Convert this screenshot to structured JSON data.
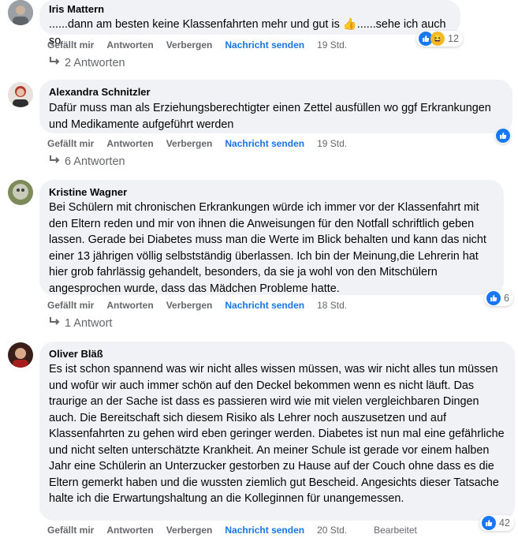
{
  "comments": [
    {
      "author": "Iris Mattern",
      "text": "......dann am besten keine Klassenfahrten mehr und gut is 👍......sehe ich auch so",
      "actions": {
        "like": "Gefällt mir",
        "reply": "Antworten",
        "hide": "Verbergen",
        "send": "Nachricht senden",
        "time": "19 Std."
      },
      "reaction_count": "12",
      "replies": "2 Antworten"
    },
    {
      "author": "Alexandra Schnitzler",
      "text": "Dafür muss man als Erziehungsberechtigter einen Zettel ausfüllen wo ggf Erkrankungen und Medikamente aufgeführt werden",
      "actions": {
        "like": "Gefällt mir",
        "reply": "Antworten",
        "hide": "Verbergen",
        "send": "Nachricht senden",
        "time": "19 Std."
      },
      "replies": "6 Antworten"
    },
    {
      "author": "Kristine Wagner",
      "text": "Bei Schülern mit chronischen Erkrankungen würde ich immer vor der Klassenfahrt mit den Eltern reden und mir von ihnen die Anweisungen für den Notfall schriftlich geben lassen. Gerade bei Diabetes muss man die Werte im Blick behalten und kann das nicht einer 13 jährigen völlig selbstständig überlassen. Ich bin der Meinung,die Lehrerin hat hier grob fahrlässig gehandelt, besonders, da sie ja wohl von den Mitschülern angesprochen wurde, dass das Mädchen Probleme hatte.",
      "actions": {
        "like": "Gefällt mir",
        "reply": "Antworten",
        "hide": "Verbergen",
        "send": "Nachricht senden",
        "time": "18 Std."
      },
      "reaction_count": "6",
      "replies": "1 Antwort"
    },
    {
      "author": "Oliver Bläß",
      "text": "Es ist schon spannend was wir nicht alles wissen müssen, was wir nicht alles tun müssen und wofür wir auch immer schön auf den Deckel bekommen wenn es nicht läuft. Das traurige an der Sache ist dass es passieren wird wie mit vielen vergleichbaren Dingen auch. Die Bereitschaft sich diesem Risiko als Lehrer noch auszusetzen und auf Klassenfahrten zu gehen wird eben geringer werden. Diabetes ist nun mal eine gefährliche und nicht selten unterschätzte Krankheit. An meiner Schule ist gerade vor einem halben Jahr eine Schülerin an Unterzucker gestorben zu Hause auf der Couch ohne dass es die Eltern gemerkt haben und die wussten ziemlich gut Bescheid. Angesichts dieser Tatsache halte ich die Erwartungshaltung an die Kolleginnen für unangemessen.",
      "actions": {
        "like": "Gefällt mir",
        "reply": "Antworten",
        "hide": "Verbergen",
        "send": "Nachricht senden",
        "time": "20 Std.",
        "edited": "Bearbeitet"
      },
      "reaction_count": "42"
    }
  ],
  "colors": {
    "bubble": "#f0f2f5",
    "link": "#1b74e4",
    "secondary": "#65676b",
    "like_blue": "#1877f2"
  }
}
